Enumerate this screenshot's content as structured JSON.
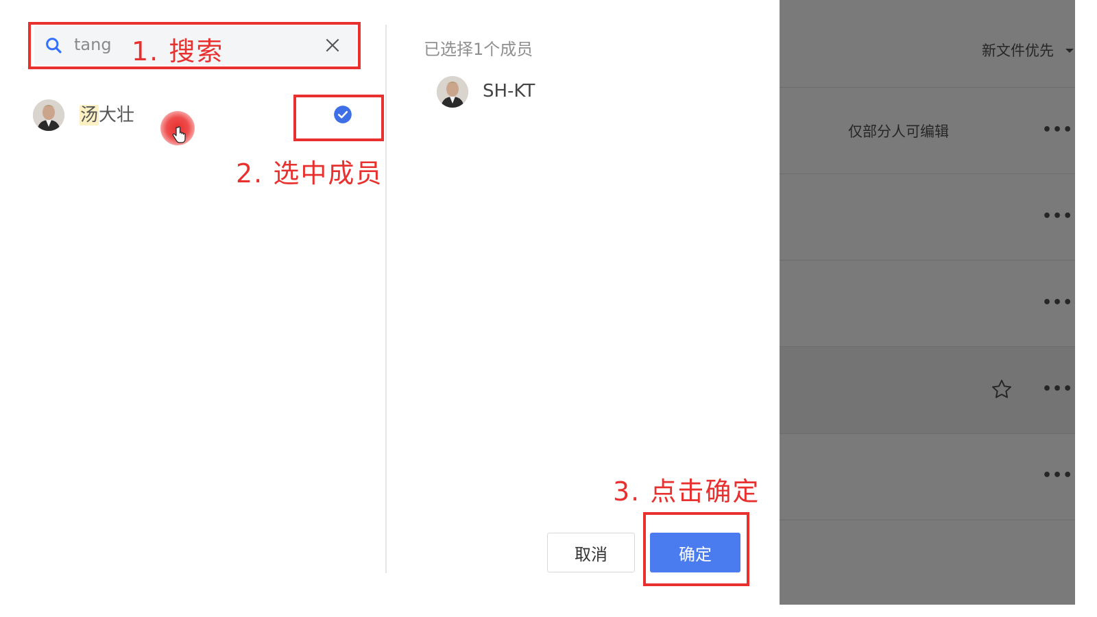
{
  "background": {
    "sort_label": "新文件优先",
    "permission_text": "仅部分人可编辑",
    "more_label": "•••"
  },
  "search": {
    "value": "tang"
  },
  "results": [
    {
      "name_highlight": "汤",
      "name_rest": "大壮",
      "selected": true
    }
  ],
  "selected_panel": {
    "title": "已选择1个成员",
    "members": [
      {
        "name": "SH-KT"
      }
    ]
  },
  "buttons": {
    "cancel": "取消",
    "confirm": "确定"
  },
  "annotations": {
    "step1": "1. 搜索",
    "step2": "2. 选中成员",
    "step3": "3. 点击确定"
  },
  "colors": {
    "accent": "#4a7cf0",
    "annotation": "#e8302f",
    "overlay": "#7a7a7a"
  },
  "icons": {
    "search": "search-icon",
    "clear": "close-icon",
    "check": "check-circle-icon",
    "more": "more-icon",
    "star": "star-icon",
    "sort": "chevron-down-icon"
  }
}
